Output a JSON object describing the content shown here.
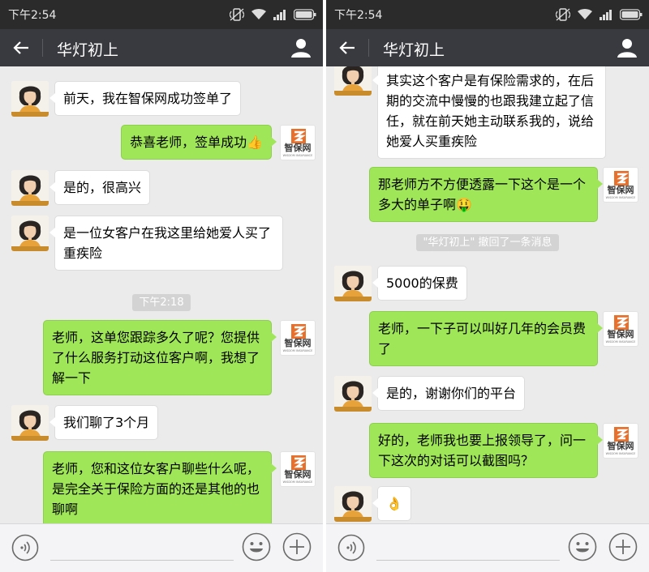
{
  "status_bar": {
    "time": "下午2:54"
  },
  "chat": {
    "title": "华灯初上",
    "back_icon": "back-arrow-icon",
    "profile_icon": "person-icon"
  },
  "brand": {
    "name": "智保网",
    "subtitle": "WISDOM INSURANCE",
    "accent": "#e8702a"
  },
  "colors": {
    "outgoing_bubble": "#9fe658",
    "incoming_bubble": "#ffffff",
    "navbar": "#393a3f",
    "statusbar": "#2b2b2b"
  },
  "left_panel": {
    "messages": [
      {
        "from": "contact",
        "text": "前天，我在智保网成功签单了"
      },
      {
        "from": "me",
        "text": "恭喜老师，签单成功👍"
      },
      {
        "from": "contact",
        "text": "是的，很高兴"
      },
      {
        "from": "contact",
        "text": "是一位女客户在我这里给她爱人买了重疾险"
      },
      {
        "type": "time",
        "text": "下午2:18"
      },
      {
        "from": "me",
        "text": "老师，这单您跟踪多久了呢？您提供了什么服务打动这位客户啊，我想了解一下"
      },
      {
        "from": "contact",
        "text": "我们聊了3个月"
      },
      {
        "from": "me",
        "text": "老师，您和这位女客户聊些什么呢，是完全关于保险方面的还是其他的也聊啊"
      }
    ]
  },
  "right_panel": {
    "messages": [
      {
        "from": "contact",
        "text": "其实这个客户是有保险需求的，在后期的交流中慢慢的也跟我建立起了信任，就在前天她主动联系我的，说给她爱人买重疾险"
      },
      {
        "from": "me",
        "text": "那老师方不方便透露一下这个是一个多大的单子啊🤑"
      },
      {
        "type": "notice",
        "text": "\"华灯初上\" 撤回了一条消息"
      },
      {
        "from": "contact",
        "text": "5000的保费"
      },
      {
        "from": "me",
        "text": "老师，一下子可以叫好几年的会员费了"
      },
      {
        "from": "contact",
        "text": "是的，谢谢你们的平台"
      },
      {
        "from": "me",
        "text": "好的，老师我也要上报领导了，问一下这次的对话可以截图吗？"
      },
      {
        "from": "contact",
        "text": "👌"
      }
    ]
  },
  "input_bar": {
    "voice_icon": "voice-icon",
    "emoji_icon": "emoji-icon",
    "more_icon": "plus-icon"
  }
}
